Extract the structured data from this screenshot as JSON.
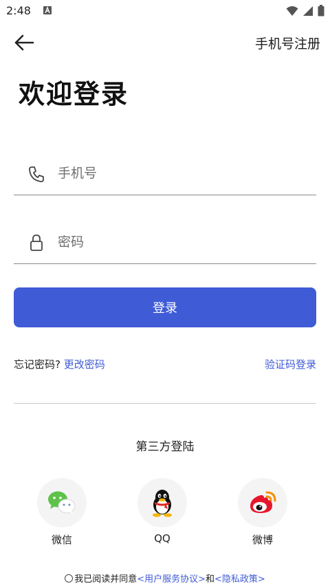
{
  "status_bar": {
    "time": "2:48"
  },
  "header": {
    "register_link": "手机号注册"
  },
  "title": "欢迎登录",
  "form": {
    "phone_placeholder": "手机号",
    "password_placeholder": "密码",
    "login_button": "登录"
  },
  "links": {
    "forgot_text": "忘记密码?",
    "change_password": "更改密码",
    "code_login": "验证码登录"
  },
  "third_party": {
    "title": "第三方登陆",
    "items": [
      {
        "label": "微信",
        "icon": "wechat-icon"
      },
      {
        "label": "QQ",
        "icon": "qq-icon"
      },
      {
        "label": "微博",
        "icon": "weibo-icon"
      }
    ]
  },
  "agreement": {
    "prefix": "我已阅读并同意",
    "user_agreement": "<用户服务协议>",
    "and": "和",
    "privacy_policy": "<隐私政策>"
  },
  "colors": {
    "accent": "#3f5bd6",
    "background": "#ffffff"
  }
}
